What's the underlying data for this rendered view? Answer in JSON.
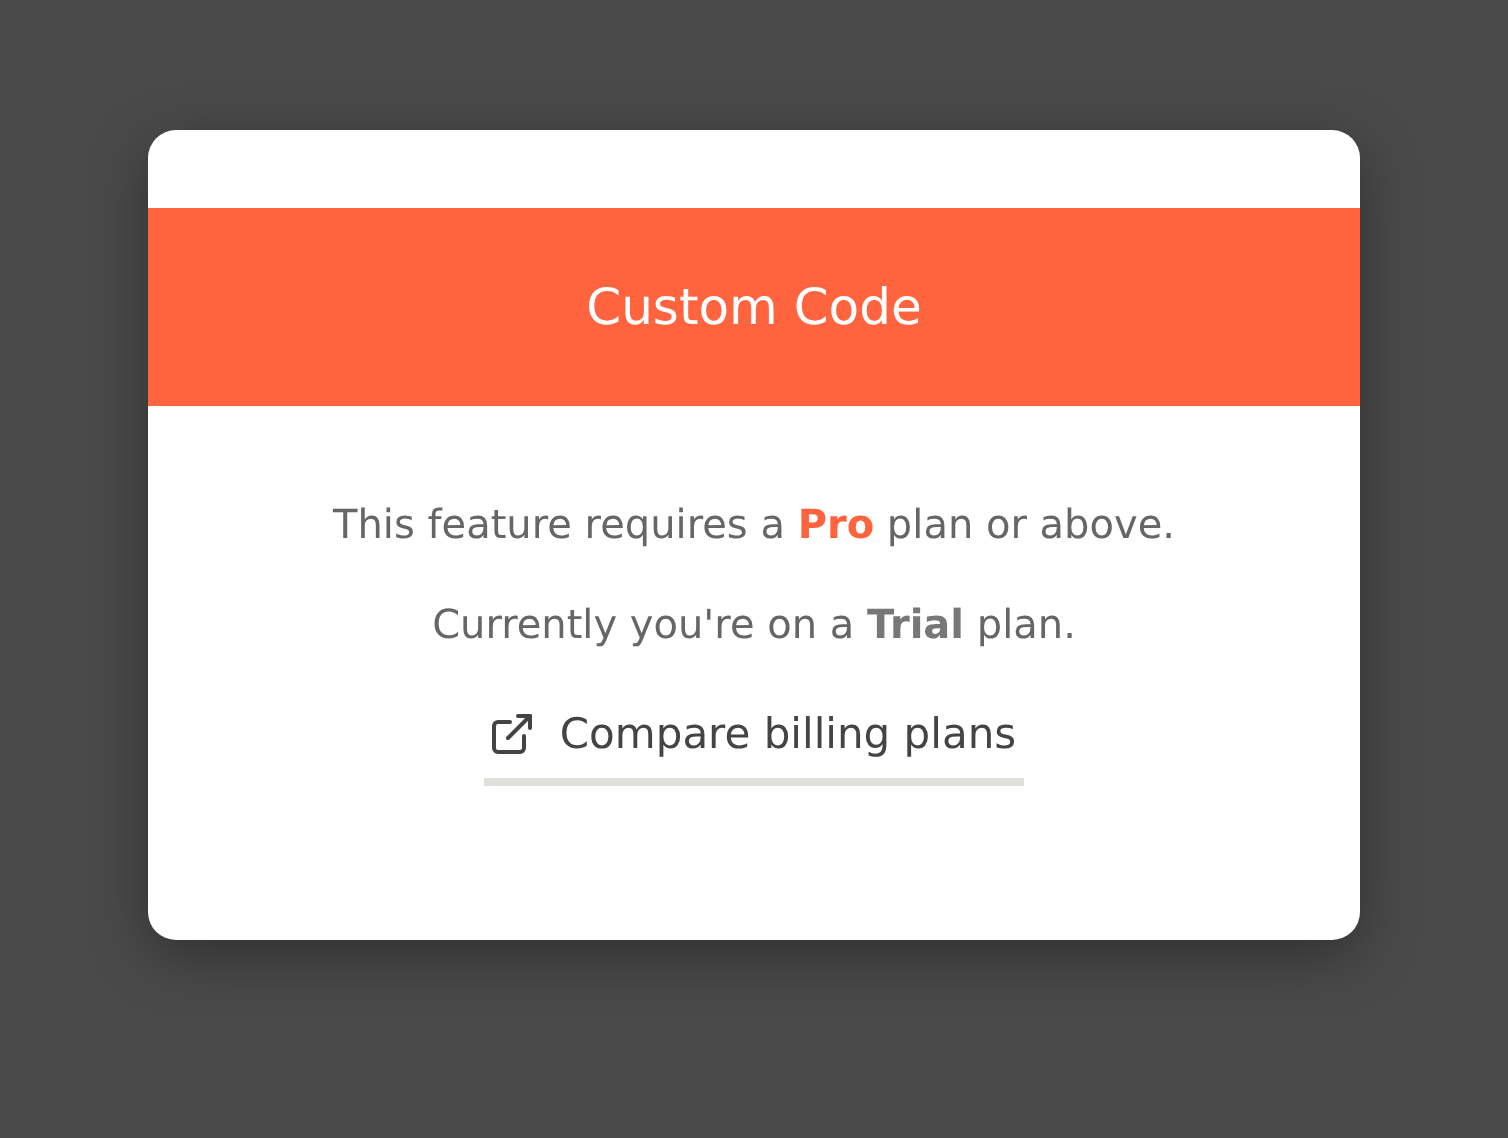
{
  "dialog": {
    "title": "Custom Code",
    "message": "This feature requires a **Pro** plan or above.",
    "current_plan": "Currently you're on a **Trial** plan.",
    "link": {
      "label": "Compare billing plans"
    }
  }
}
